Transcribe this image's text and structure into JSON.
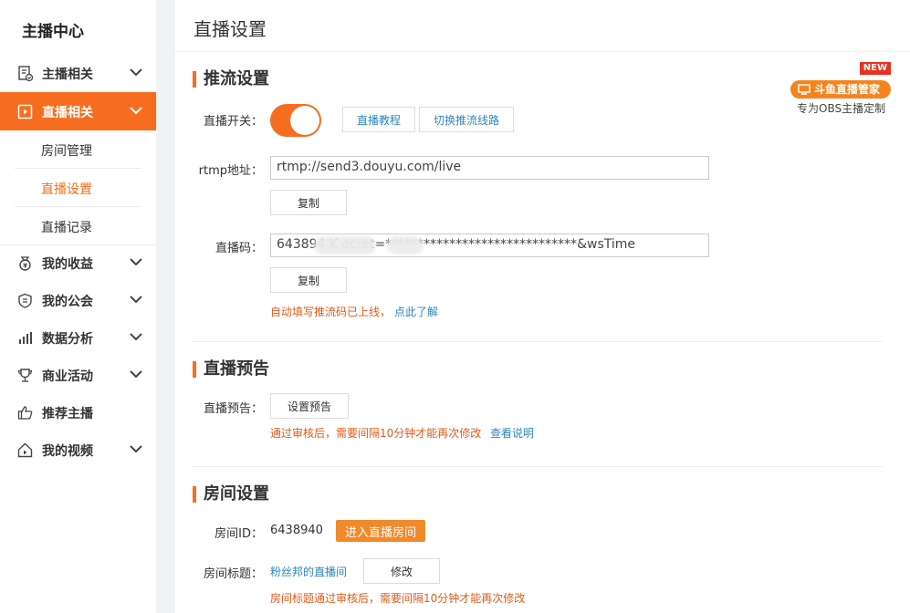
{
  "sidebar": {
    "title": "主播中心",
    "items": [
      {
        "label": "主播相关"
      },
      {
        "label": "直播相关"
      },
      {
        "label": "我的收益"
      },
      {
        "label": "我的公会"
      },
      {
        "label": "数据分析"
      },
      {
        "label": "商业活动"
      },
      {
        "label": "推荐主播"
      },
      {
        "label": "我的视频"
      }
    ],
    "subitems": [
      {
        "label": "房间管理"
      },
      {
        "label": "直播设置"
      },
      {
        "label": "直播记录"
      }
    ]
  },
  "page": {
    "title": "直播设置"
  },
  "promo": {
    "badge": "NEW",
    "label": "斗鱼直播管家",
    "subtitle": "专为OBS主播定制"
  },
  "stream": {
    "heading": "推流设置",
    "switch_label": "直播开关：",
    "switch_on": true,
    "tutorial_button": "直播教程",
    "switch_route_button": "切换推流线路",
    "rtmp_label": "rtmp地址：",
    "rtmp_value": "rtmp://send3.douyu.com/live",
    "copy_button": "复制",
    "code_label": "直播码：",
    "code_value": "643894          K         ecret=******************************&wsTime",
    "copy_button_2": "复制",
    "autofill_note": "自动填写推流码已上线，",
    "autofill_link": "点此了解"
  },
  "preview": {
    "heading": "直播预告",
    "label": "直播预告：",
    "button": "设置预告",
    "note": "通过审核后，需要间隔10分钟才能再次修改",
    "link": "查看说明"
  },
  "room": {
    "heading": "房间设置",
    "id_label": "房间ID：",
    "id_value": "6438940",
    "enter_button": "进入直播房间",
    "title_label": "房间标题：",
    "title_value": "粉丝邦的直播间",
    "edit_button": "修改",
    "title_note": "房间标题通过审核后，需要间隔10分钟才能再次修改"
  },
  "colors": {
    "accent": "#f66d1f",
    "link": "#2e86c1",
    "note": "#e05a1a"
  }
}
